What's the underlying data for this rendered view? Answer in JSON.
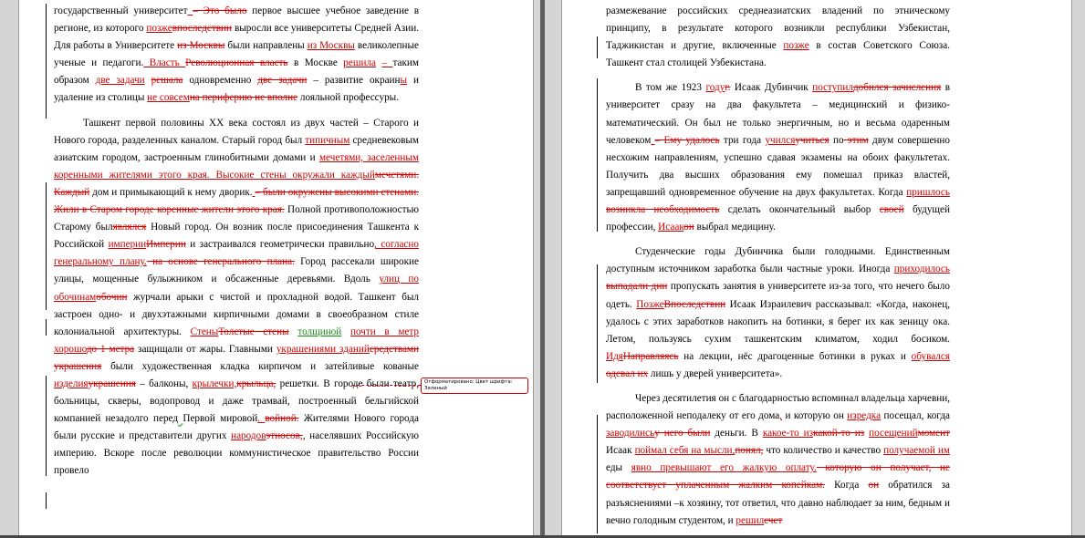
{
  "left_page": {
    "paragraphs": [
      [
        [
          "n",
          "государственный университет"
        ],
        [
          "i",
          "  "
        ],
        [
          "d",
          "– Это было"
        ],
        [
          "n",
          " первое высшее учебное заведение в регионе, из которого "
        ],
        [
          "i",
          "позже"
        ],
        [
          "d",
          "впоследствии"
        ],
        [
          "n",
          " выросли все университеты Средней Азии. Для работы в Университете "
        ],
        [
          "d",
          "из Москвы"
        ],
        [
          "n",
          " были направлены "
        ],
        [
          "i",
          "из Москвы"
        ],
        [
          "n",
          " великолепные ученые и педагоги."
        ],
        [
          "i",
          "  Власть "
        ],
        [
          "d",
          "Революционная власть"
        ],
        [
          "n",
          " в Москве "
        ],
        [
          "i",
          "решила"
        ],
        [
          "n",
          "  "
        ],
        [
          "i",
          "– "
        ],
        [
          "n",
          "таким образом "
        ],
        [
          "i",
          "две задачи"
        ],
        [
          "n",
          " "
        ],
        [
          "d",
          "решала"
        ],
        [
          "n",
          " одновременно "
        ],
        [
          "d",
          "две задачи"
        ],
        [
          "n",
          " – развитие окраин"
        ],
        [
          "i",
          "ы"
        ],
        [
          "n",
          " и удаление из столицы "
        ],
        [
          "i",
          "не совсем"
        ],
        [
          "d",
          "на периферию не вполне"
        ],
        [
          "n",
          " лояльной профессуры."
        ]
      ],
      [
        [
          "n",
          "Ташкент первой половины XX века состоял из двух частей – Старого и Нового города, разделенных каналом. Старый город был "
        ],
        [
          "i",
          "типичным"
        ],
        [
          "n",
          " средневековым азиатским городом, застроенным глинобитными домами и "
        ],
        [
          "i",
          "мечетями, заселенным коренными жителями этого края. Высокие стены окружали каждый"
        ],
        [
          "d",
          "мечетями. Каждый"
        ],
        [
          "n",
          " дом и примыкающий к нему дворик."
        ],
        [
          "i",
          "  "
        ],
        [
          "d",
          "– были окружены высокими стенами. Жили в Старом городе коренные жители этого края."
        ],
        [
          "n",
          "  Полной противоположностью Старому был"
        ],
        [
          "d",
          "являлся"
        ],
        [
          "n",
          " Новый город. Он возник после присоединения Ташкента к Российской "
        ],
        [
          "i",
          "империи"
        ],
        [
          "d",
          "Империи"
        ],
        [
          "n",
          " и застраивался геометрически правильно"
        ],
        [
          "i",
          ", согласно генеральному плану."
        ],
        [
          "d",
          "  на основе генерального плана."
        ],
        [
          "n",
          " Город рассекали широкие улицы, мощенные булыжником и обсаженные деревьями. Вдоль "
        ],
        [
          "i",
          "улиц по обочинам"
        ],
        [
          "d",
          "обочин"
        ],
        [
          "n",
          " журчали арыки с чистой и прохладной водой. Ташкент был застроен одно- и двухэтажными кирпичными домами в своеобразном стиле колониальной архитектуры. "
        ],
        [
          "i",
          "Стены"
        ],
        [
          "d",
          "Толстые стены"
        ],
        [
          "n",
          " "
        ],
        [
          "g",
          "толщиной"
        ],
        [
          "n",
          " "
        ],
        [
          "i",
          "почти в метр хорошо"
        ],
        [
          "d",
          "до 1 метра"
        ],
        [
          "n",
          " защищали от жары. Главными "
        ],
        [
          "i",
          "украшениями зданий"
        ],
        [
          "d",
          "средствами украшения"
        ],
        [
          "n",
          " были художественная кладка кирпичом и затейливые кованые "
        ],
        [
          "i",
          "изделия"
        ],
        [
          "d",
          "украшения"
        ],
        [
          "n",
          " – балконы, "
        ],
        [
          "i",
          "крылечки,"
        ],
        [
          "d",
          "крыльца,"
        ],
        [
          "n",
          " решетки. В городе были театр, больницы, скверы, водопровод и даже трамвай, построенный бельгийской компанией незадолго перед"
        ],
        [
          "s",
          "  "
        ],
        [
          "n",
          "Первой мировой"
        ],
        [
          "i",
          ". "
        ],
        [
          "d",
          "войной."
        ],
        [
          "n",
          " Жителями Нового города были русские и представители других "
        ],
        [
          "i",
          "народов"
        ],
        [
          "d",
          "этносов,"
        ],
        [
          "n",
          ", населявших Российскую империю. Вскоре после революции коммунистическое правительство России провело"
        ]
      ]
    ],
    "balloon_text": "Отформатировано: Цвет шрифта: Зеленый"
  },
  "right_page": {
    "paragraphs": [
      [
        [
          "n",
          "размежевание российских среднеазиатских владений по этническому принципу, в результате которого возникли республики Узбекистан, Таджикистан и другие, включенные "
        ],
        [
          "i",
          "позже"
        ],
        [
          "n",
          "  в состав Советского Союза. Ташкент стал столицей Узбекистана."
        ]
      ],
      [
        [
          "n",
          "В том же 1923 "
        ],
        [
          "i",
          "году"
        ],
        [
          "d",
          "г."
        ],
        [
          "n",
          " Исаак Дубинчик "
        ],
        [
          "i",
          "поступил"
        ],
        [
          "d",
          "добился зачисления"
        ],
        [
          "n",
          " в университет сразу на два факультета – медицинский и физико-математический. Он был не только энергичным, но и весьма одаренным человеком"
        ],
        [
          "i",
          "  "
        ],
        [
          "d",
          "– Ему   удалось"
        ],
        [
          "n",
          " три года "
        ],
        [
          "i",
          "учился"
        ],
        [
          "d",
          "учиться"
        ],
        [
          "n",
          " по"
        ],
        [
          "d",
          "  этим"
        ],
        [
          "n",
          " двум совершенно несхожим направлениям, успешно сдавая экзамены на обоих факультетах. Получить два высших образования ему помешал приказ властей, запрещавший одновременное обучение на двух факультетах. Когда "
        ],
        [
          "i",
          "пришлось"
        ],
        [
          "d",
          "  возникла необходимость"
        ],
        [
          "n",
          " сделать окончательный выбор "
        ],
        [
          "d",
          "своей"
        ],
        [
          "n",
          " будущей профессии, "
        ],
        [
          "i",
          "Исаак"
        ],
        [
          "d",
          "он"
        ],
        [
          "n",
          " выбрал медицину."
        ]
      ],
      [
        [
          "n",
          "Студенческие годы Дубинчика были голодными. Единственным доступным источником заработка были частные уроки. Иногда "
        ],
        [
          "i",
          "приходилось"
        ],
        [
          "d",
          "  выпадали дни"
        ],
        [
          "n",
          " пропускать занятия в университете из-за того, что нечего было одеть. "
        ],
        [
          "i",
          "Позже"
        ],
        [
          "d",
          "Впоследствии"
        ],
        [
          "n",
          " Исаак Израилевич рассказывал: «Когда, наконец, удалось с этих заработков накопить на ботинки, я берег их как зеницу ока. Летом, пользуясь сухим ташкентским климатом, ходил босиком. "
        ],
        [
          "i",
          "Идя"
        ],
        [
          "d",
          "Направляясь"
        ],
        [
          "n",
          " на лекции, нёс драгоценные ботинки в руках и "
        ],
        [
          "i",
          "обувался"
        ],
        [
          "d",
          "  одевал их"
        ],
        [
          "n",
          " лишь у дверей университета»."
        ]
      ],
      [
        [
          "n",
          "Через десятилетия он с благодарностью вспоминал владельца харчевни, расположенной неподалеку от его дома"
        ],
        [
          "i",
          ","
        ],
        [
          "n",
          " и которую он "
        ],
        [
          "i",
          "изредка"
        ],
        [
          "n",
          " посещал, когда "
        ],
        [
          "i",
          "заводились"
        ],
        [
          "d",
          "у него были"
        ],
        [
          "n",
          " деньги. В "
        ],
        [
          "i",
          "какое-то из"
        ],
        [
          "d",
          "какой-то из"
        ],
        [
          "n",
          " "
        ],
        [
          "i",
          "посещений"
        ],
        [
          "d",
          "момент"
        ],
        [
          "n",
          " Исаак "
        ],
        [
          "i",
          "поймал себя на мысли,"
        ],
        [
          "d",
          "понял,"
        ],
        [
          "n",
          " что количество и качество "
        ],
        [
          "i",
          "получаемой им"
        ],
        [
          "n",
          " еды "
        ],
        [
          "i",
          "явно превышают его жалкую оплату."
        ],
        [
          "d",
          "  которую он получает, не соответствует уплаченным жалким копейкам."
        ],
        [
          "n",
          " Когда "
        ],
        [
          "d",
          "он"
        ],
        [
          "n",
          " обратился за разъяснениями –к хозяину, тот ответил, что давно наблюдает за ним, бедным и вечно голодным студентом, и "
        ],
        [
          "i",
          "решил"
        ],
        [
          "d",
          "счет"
        ]
      ]
    ]
  }
}
